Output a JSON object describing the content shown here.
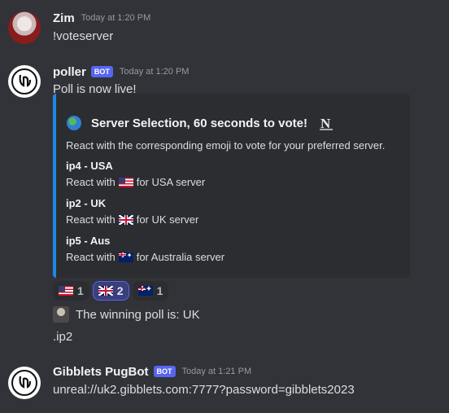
{
  "messages": {
    "zim": {
      "username": "Zim",
      "timestamp": "Today at 1:20 PM",
      "text": "!voteserver"
    },
    "poller": {
      "username": "poller",
      "bot_tag": "BOT",
      "timestamp": "Today at 1:20 PM",
      "text": "Poll is now live!"
    },
    "pugbot": {
      "username": "Gibblets PugBot",
      "bot_tag": "BOT",
      "timestamp": "Today at 1:21 PM",
      "text": "unreal://uk2.gibblets.com:7777?password=gibblets2023"
    }
  },
  "embed": {
    "title": "Server Selection, 60 seconds to vote!",
    "description": "React with the corresponding emoji to vote for your preferred server.",
    "accent_color": "#1e88e5",
    "fields": [
      {
        "name": "ip4 - USA",
        "prefix": "React with",
        "suffix": "for USA server",
        "flag": "flag-us"
      },
      {
        "name": "ip2 - UK",
        "prefix": "React with",
        "suffix": "for UK server",
        "flag": "flag-uk"
      },
      {
        "name": "ip5 - Aus",
        "prefix": "React with",
        "suffix": "for Australia server",
        "flag": "flag-au"
      }
    ]
  },
  "reactions": [
    {
      "emoji": "flag-us",
      "count": "1",
      "active": false
    },
    {
      "emoji": "flag-uk",
      "count": "2",
      "active": true
    },
    {
      "emoji": "flag-au",
      "count": "1",
      "active": false
    }
  ],
  "result": {
    "winning_text": "The winning poll is: UK",
    "ip_text": ".ip2"
  },
  "colors": {
    "background": "#313338",
    "bot_tag": "#5865f2",
    "embed_bg": "#2b2d31"
  }
}
